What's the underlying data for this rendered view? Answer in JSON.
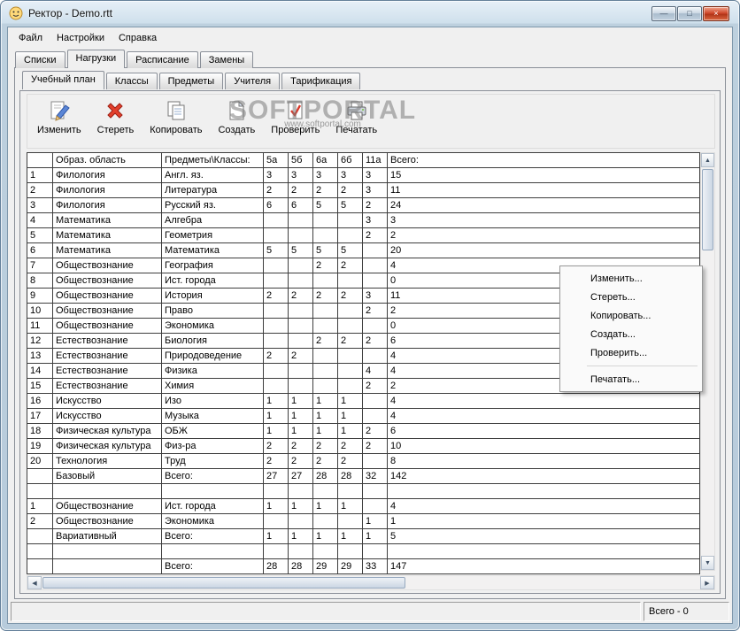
{
  "window": {
    "title": "Ректор - Demo.rtt",
    "controls": [
      {
        "name": "minimize",
        "glyph": "—"
      },
      {
        "name": "maximize",
        "glyph": "□"
      },
      {
        "name": "close",
        "glyph": "×"
      }
    ]
  },
  "menubar": {
    "items": [
      {
        "name": "file",
        "label": "Файл"
      },
      {
        "name": "settings",
        "label": "Настройки"
      },
      {
        "name": "help",
        "label": "Справка"
      }
    ]
  },
  "main_tabs": [
    {
      "name": "spiski",
      "label": "Списки",
      "active": false
    },
    {
      "name": "nagruzki",
      "label": "Нагрузки",
      "active": true
    },
    {
      "name": "raspisanie",
      "label": "Расписание",
      "active": false
    },
    {
      "name": "zameny",
      "label": "Замены",
      "active": false
    }
  ],
  "sub_tabs": [
    {
      "name": "uchebnyj-plan",
      "label": "Учебный план",
      "active": true
    },
    {
      "name": "klassy",
      "label": "Классы",
      "active": false
    },
    {
      "name": "predmety",
      "label": "Предметы",
      "active": false
    },
    {
      "name": "uchitelya",
      "label": "Учителя",
      "active": false
    },
    {
      "name": "tarifikatsiya",
      "label": "Тарификация",
      "active": false
    }
  ],
  "toolbar": {
    "buttons": [
      {
        "name": "edit",
        "label": "Изменить",
        "icon": "edit-icon"
      },
      {
        "name": "erase",
        "label": "Стереть",
        "icon": "erase-icon"
      },
      {
        "name": "copy",
        "label": "Копировать",
        "icon": "copy-icon"
      },
      {
        "name": "create",
        "label": "Создать",
        "icon": "create-icon"
      },
      {
        "name": "check",
        "label": "Проверить",
        "icon": "check-icon"
      },
      {
        "name": "print",
        "label": "Печатать",
        "icon": "print-icon"
      }
    ]
  },
  "watermark": {
    "title": "SOFTPORTAL",
    "subtitle": "www.softportal.com"
  },
  "table": {
    "headers": {
      "num": "",
      "area": "Образ. область",
      "subject": "Предметы\\Классы:",
      "classes": [
        "5а",
        "5б",
        "6а",
        "6б",
        "11а"
      ],
      "total": "Всего:"
    },
    "rows": [
      {
        "type": "data",
        "num": "1",
        "area": "Филология",
        "subject": "Англ. яз.",
        "values": [
          "3",
          "3",
          "3",
          "3",
          "3"
        ],
        "total": "15"
      },
      {
        "type": "data",
        "num": "2",
        "area": "Филология",
        "subject": "Литература",
        "values": [
          "2",
          "2",
          "2",
          "2",
          "3"
        ],
        "total": "11"
      },
      {
        "type": "data",
        "num": "3",
        "area": "Филология",
        "subject": "Русский яз.",
        "values": [
          "6",
          "6",
          "5",
          "5",
          "2"
        ],
        "total": "24"
      },
      {
        "type": "data",
        "num": "4",
        "area": "Математика",
        "subject": "Алгебра",
        "values": [
          "",
          "",
          "",
          "",
          "3"
        ],
        "total": "3"
      },
      {
        "type": "data",
        "num": "5",
        "area": "Математика",
        "subject": "Геометрия",
        "values": [
          "",
          "",
          "",
          "",
          "2"
        ],
        "total": "2"
      },
      {
        "type": "data",
        "num": "6",
        "area": "Математика",
        "subject": "Математика",
        "values": [
          "5",
          "5",
          "5",
          "5",
          ""
        ],
        "total": "20"
      },
      {
        "type": "data",
        "num": "7",
        "area": "Обществознание",
        "subject": "География",
        "values": [
          "",
          "",
          "2",
          "2",
          ""
        ],
        "total": "4"
      },
      {
        "type": "data",
        "num": "8",
        "area": "Обществознание",
        "subject": "Ист. города",
        "values": [
          "",
          "",
          "",
          "",
          ""
        ],
        "total": "0"
      },
      {
        "type": "data",
        "num": "9",
        "area": "Обществознание",
        "subject": "История",
        "values": [
          "2",
          "2",
          "2",
          "2",
          "3"
        ],
        "total": "11"
      },
      {
        "type": "data",
        "num": "10",
        "area": "Обществознание",
        "subject": "Право",
        "values": [
          "",
          "",
          "",
          "",
          "2"
        ],
        "total": "2"
      },
      {
        "type": "data",
        "num": "11",
        "area": "Обществознание",
        "subject": "Экономика",
        "values": [
          "",
          "",
          "",
          "",
          ""
        ],
        "total": "0"
      },
      {
        "type": "data",
        "num": "12",
        "area": "Естествознание",
        "subject": "Биология",
        "values": [
          "",
          "",
          "2",
          "2",
          "2"
        ],
        "total": "6"
      },
      {
        "type": "data",
        "num": "13",
        "area": "Естествознание",
        "subject": "Природоведение",
        "values": [
          "2",
          "2",
          "",
          "",
          ""
        ],
        "total": "4"
      },
      {
        "type": "data",
        "num": "14",
        "area": "Естествознание",
        "subject": "Физика",
        "values": [
          "",
          "",
          "",
          "",
          "4"
        ],
        "total": "4"
      },
      {
        "type": "data",
        "num": "15",
        "area": "Естествознание",
        "subject": "Химия",
        "values": [
          "",
          "",
          "",
          "",
          "2"
        ],
        "total": "2"
      },
      {
        "type": "data",
        "num": "16",
        "area": "Искусство",
        "subject": "Изо",
        "values": [
          "1",
          "1",
          "1",
          "1",
          ""
        ],
        "total": "4"
      },
      {
        "type": "data",
        "num": "17",
        "area": "Искусство",
        "subject": "Музыка",
        "values": [
          "1",
          "1",
          "1",
          "1",
          ""
        ],
        "total": "4"
      },
      {
        "type": "data",
        "num": "18",
        "area": "Физическая культура",
        "subject": "ОБЖ",
        "values": [
          "1",
          "1",
          "1",
          "1",
          "2"
        ],
        "total": "6"
      },
      {
        "type": "data",
        "num": "19",
        "area": "Физическая культура",
        "subject": "Физ-ра",
        "values": [
          "2",
          "2",
          "2",
          "2",
          "2"
        ],
        "total": "10"
      },
      {
        "type": "data",
        "num": "20",
        "area": "Технология",
        "subject": "Труд",
        "values": [
          "2",
          "2",
          "2",
          "2",
          ""
        ],
        "total": "8"
      },
      {
        "type": "summary",
        "num": "",
        "area": "Базовый",
        "subject": "Всего:",
        "values": [
          "27",
          "27",
          "28",
          "28",
          "32"
        ],
        "total": "142"
      },
      {
        "type": "empty",
        "num": "",
        "area": "",
        "subject": "",
        "values": [
          "",
          "",
          "",
          "",
          ""
        ],
        "total": ""
      },
      {
        "type": "data",
        "num": "1",
        "area": "Обществознание",
        "subject": "Ист. города",
        "values": [
          "1",
          "1",
          "1",
          "1",
          ""
        ],
        "total": "4"
      },
      {
        "type": "data",
        "num": "2",
        "area": "Обществознание",
        "subject": "Экономика",
        "values": [
          "",
          "",
          "",
          "",
          "1"
        ],
        "total": "1"
      },
      {
        "type": "summary",
        "num": "",
        "area": "Вариативный",
        "subject": "Всего:",
        "values": [
          "1",
          "1",
          "1",
          "1",
          "1"
        ],
        "total": "5"
      },
      {
        "type": "empty",
        "num": "",
        "area": "",
        "subject": "",
        "values": [
          "",
          "",
          "",
          "",
          ""
        ],
        "total": ""
      },
      {
        "type": "summary",
        "num": "",
        "area": "",
        "subject": "Всего:",
        "values": [
          "28",
          "28",
          "29",
          "29",
          "33"
        ],
        "total": "147"
      },
      {
        "type": "partial",
        "num": "",
        "area": "",
        "subject": "",
        "values": [
          "",
          "",
          "",
          "",
          ""
        ],
        "total": ""
      }
    ]
  },
  "context_menu": {
    "items": [
      {
        "name": "edit",
        "label": "Изменить...",
        "separator_before": false
      },
      {
        "name": "erase",
        "label": "Стереть...",
        "separator_before": false
      },
      {
        "name": "copy",
        "label": "Копировать...",
        "separator_before": false
      },
      {
        "name": "create",
        "label": "Создать...",
        "separator_before": false
      },
      {
        "name": "check",
        "label": "Проверить...",
        "separator_before": false
      },
      {
        "name": "print",
        "label": "Печатать...",
        "separator_before": true
      }
    ]
  },
  "icons": {
    "scroll_up": "▲",
    "scroll_down": "▼",
    "scroll_left": "◀",
    "scroll_right": "▶"
  },
  "statusbar": {
    "total_label": "Всего - 0"
  },
  "colors": {
    "cell_green": "#a0f1a0",
    "summary_gray": "#d8d8d8",
    "titlebar_top": "#e7f0f8",
    "frame_blue": "#b7cbdb",
    "close_red": "#cc4427"
  }
}
